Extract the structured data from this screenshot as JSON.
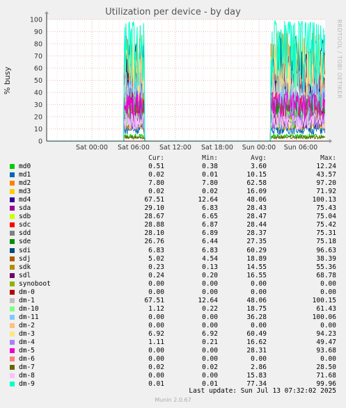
{
  "chart_data": {
    "type": "line",
    "title": "Utilization per device - by day",
    "ylabel": "% busy",
    "ylim": [
      0,
      100
    ],
    "yticks": [
      "0",
      "10",
      "20",
      "30",
      "40",
      "50",
      "60",
      "70",
      "80",
      "90",
      "100"
    ],
    "xticks": [
      "Sat 00:00",
      "Sat 06:00",
      "Sat 12:00",
      "Sat 18:00",
      "Sun 00:00",
      "Sun 06:00"
    ],
    "x_range_hours": [
      -6.5,
      33.5
    ],
    "series": [
      {
        "name": "md0",
        "color": "#00cc00",
        "level": 4
      },
      {
        "name": "md1",
        "color": "#0066b3",
        "level": 10
      },
      {
        "name": "md2",
        "color": "#ff8000",
        "level": 62
      },
      {
        "name": "md3",
        "color": "#ffcc00",
        "level": 16
      },
      {
        "name": "md4",
        "color": "#330099",
        "level": 48
      },
      {
        "name": "sda",
        "color": "#990099",
        "level": 28
      },
      {
        "name": "sdb",
        "color": "#ccff00",
        "level": 28
      },
      {
        "name": "sdc",
        "color": "#ff0000",
        "level": 28
      },
      {
        "name": "sdd",
        "color": "#808080",
        "level": 28
      },
      {
        "name": "sde",
        "color": "#008f00",
        "level": 27
      },
      {
        "name": "sdi",
        "color": "#00487d",
        "level": 60
      },
      {
        "name": "sdj",
        "color": "#b35a00",
        "level": 19
      },
      {
        "name": "sdk",
        "color": "#b38f00",
        "level": 15
      },
      {
        "name": "sdl",
        "color": "#6b006b",
        "level": 17
      },
      {
        "name": "synoboot",
        "color": "#8fb300",
        "level": 0
      },
      {
        "name": "dm-0",
        "color": "#b30000",
        "level": 0
      },
      {
        "name": "dm-1",
        "color": "#bebebe",
        "level": 48
      },
      {
        "name": "dm-10",
        "color": "#80ff80",
        "level": 19
      },
      {
        "name": "dm-11",
        "color": "#80c9ff",
        "level": 36
      },
      {
        "name": "dm-2",
        "color": "#ffc080",
        "level": 0
      },
      {
        "name": "dm-3",
        "color": "#ffe680",
        "level": 60
      },
      {
        "name": "dm-4",
        "color": "#aa80ff",
        "level": 17
      },
      {
        "name": "dm-5",
        "color": "#ee00cc",
        "level": 28
      },
      {
        "name": "dm-6",
        "color": "#ff8080",
        "level": 0
      },
      {
        "name": "dm-7",
        "color": "#666600",
        "level": 3
      },
      {
        "name": "dm-8",
        "color": "#ffbfff",
        "level": 16
      },
      {
        "name": "dm-9",
        "color": "#00ffcc",
        "level": 77
      }
    ]
  },
  "legend": {
    "header": {
      "cur": "Cur:",
      "min": "Min:",
      "avg": "Avg:",
      "max": "Max:"
    },
    "rows": [
      {
        "name": "md0",
        "color": "#00cc00",
        "cur": "0.51",
        "min": "0.38",
        "avg": "3.60",
        "max": "12.24"
      },
      {
        "name": "md1",
        "color": "#0066b3",
        "cur": "0.02",
        "min": "0.01",
        "avg": "10.15",
        "max": "43.57"
      },
      {
        "name": "md2",
        "color": "#ff8000",
        "cur": "7.80",
        "min": "7.80",
        "avg": "62.58",
        "max": "97.20"
      },
      {
        "name": "md3",
        "color": "#ffcc00",
        "cur": "0.02",
        "min": "0.02",
        "avg": "16.09",
        "max": "71.92"
      },
      {
        "name": "md4",
        "color": "#330099",
        "cur": "67.51",
        "min": "12.64",
        "avg": "48.06",
        "max": "100.13"
      },
      {
        "name": "sda",
        "color": "#990099",
        "cur": "29.10",
        "min": "6.83",
        "avg": "28.43",
        "max": "75.43"
      },
      {
        "name": "sdb",
        "color": "#ccff00",
        "cur": "28.67",
        "min": "6.65",
        "avg": "28.47",
        "max": "75.04"
      },
      {
        "name": "sdc",
        "color": "#ff0000",
        "cur": "28.88",
        "min": "6.87",
        "avg": "28.44",
        "max": "75.42"
      },
      {
        "name": "sdd",
        "color": "#808080",
        "cur": "28.10",
        "min": "6.89",
        "avg": "28.37",
        "max": "75.31"
      },
      {
        "name": "sde",
        "color": "#008f00",
        "cur": "26.76",
        "min": "6.44",
        "avg": "27.35",
        "max": "75.18"
      },
      {
        "name": "sdi",
        "color": "#00487d",
        "cur": "6.83",
        "min": "6.83",
        "avg": "60.29",
        "max": "96.63"
      },
      {
        "name": "sdj",
        "color": "#b35a00",
        "cur": "5.02",
        "min": "4.54",
        "avg": "18.89",
        "max": "38.39"
      },
      {
        "name": "sdk",
        "color": "#b38f00",
        "cur": "0.23",
        "min": "0.13",
        "avg": "14.55",
        "max": "55.36"
      },
      {
        "name": "sdl",
        "color": "#6b006b",
        "cur": "0.24",
        "min": "0.20",
        "avg": "16.55",
        "max": "68.78"
      },
      {
        "name": "synoboot",
        "color": "#8fb300",
        "cur": "0.00",
        "min": "0.00",
        "avg": "0.00",
        "max": "0.00"
      },
      {
        "name": "dm-0",
        "color": "#b30000",
        "cur": "0.00",
        "min": "0.00",
        "avg": "0.00",
        "max": "0.00"
      },
      {
        "name": "dm-1",
        "color": "#bebebe",
        "cur": "67.51",
        "min": "12.64",
        "avg": "48.06",
        "max": "100.15"
      },
      {
        "name": "dm-10",
        "color": "#80ff80",
        "cur": "1.12",
        "min": "0.22",
        "avg": "18.75",
        "max": "61.43"
      },
      {
        "name": "dm-11",
        "color": "#80c9ff",
        "cur": "0.00",
        "min": "0.00",
        "avg": "36.28",
        "max": "100.06"
      },
      {
        "name": "dm-2",
        "color": "#ffc080",
        "cur": "0.00",
        "min": "0.00",
        "avg": "0.00",
        "max": "0.00"
      },
      {
        "name": "dm-3",
        "color": "#ffe680",
        "cur": "6.92",
        "min": "6.92",
        "avg": "60.49",
        "max": "94.23"
      },
      {
        "name": "dm-4",
        "color": "#aa80ff",
        "cur": "1.11",
        "min": "0.21",
        "avg": "16.62",
        "max": "49.47"
      },
      {
        "name": "dm-5",
        "color": "#ee00cc",
        "cur": "0.00",
        "min": "0.00",
        "avg": "28.31",
        "max": "93.68"
      },
      {
        "name": "dm-6",
        "color": "#ff8080",
        "cur": "0.00",
        "min": "0.00",
        "avg": "0.00",
        "max": "0.00"
      },
      {
        "name": "dm-7",
        "color": "#666600",
        "cur": "0.02",
        "min": "0.02",
        "avg": "2.86",
        "max": "28.50"
      },
      {
        "name": "dm-8",
        "color": "#ffbfff",
        "cur": "0.00",
        "min": "0.00",
        "avg": "15.83",
        "max": "71.68"
      },
      {
        "name": "dm-9",
        "color": "#00ffcc",
        "cur": "0.01",
        "min": "0.01",
        "avg": "77.34",
        "max": "99.96"
      }
    ]
  },
  "last_update": "Last update: Sun Jul 13 07:32:02 2025",
  "footer": "Munin 2.0.67",
  "watermark": "RRDTOOL / TOBI OETIKER"
}
